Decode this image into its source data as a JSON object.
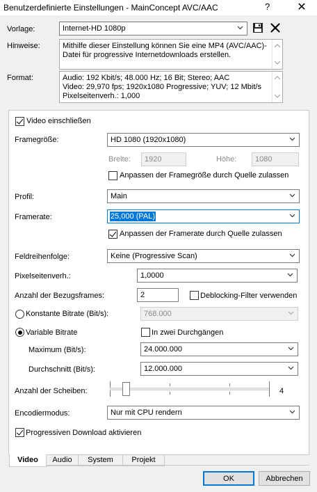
{
  "window": {
    "title": "Benutzerdefinierte Einstellungen - MainConcept AVC/AAC",
    "help": "?",
    "close": "✕"
  },
  "template": {
    "label": "Vorlage:",
    "value": "Internet-HD 1080p"
  },
  "notes": {
    "label": "Hinweise:",
    "text": "Mithilfe dieser Einstellung können Sie eine MP4 (AVC/AAC)-Datei für progressive Internetdownloads erstellen."
  },
  "format": {
    "label": "Format:",
    "lines": [
      "Audio: 192 Kbit/s; 48.000 Hz; 16 Bit; Stereo; AAC",
      "Video: 29,970 fps; 1920x1080 Progressive; YUV; 12 Mbit/s",
      "Pixelseitenverh.: 1,000"
    ]
  },
  "video": {
    "include_label": "Video einschließen",
    "include_checked": true,
    "frame_size_label": "Framegröße:",
    "frame_size_value": "HD 1080 (1920x1080)",
    "width_label": "Breite:",
    "width_value": "1920",
    "height_label": "Höhe:",
    "height_value": "1080",
    "fit_frame_label": "Anpassen der Framegröße durch Quelle zulassen",
    "fit_frame_checked": false,
    "profile_label": "Profil:",
    "profile_value": "Main",
    "framerate_label": "Framerate:",
    "framerate_value": "25,000 (PAL)",
    "fit_rate_label": "Anpassen der Framerate durch Quelle zulassen",
    "fit_rate_checked": true,
    "field_order_label": "Feldreihenfolge:",
    "field_order_value": "Keine (Progressive Scan)",
    "par_label": "Pixelseitenverh.:",
    "par_value": "1,0000",
    "ref_frames_label": "Anzahl der Bezugsframes:",
    "ref_frames_value": "2",
    "deblock_label": "Deblocking-Filter verwenden",
    "deblock_checked": false,
    "cbr_label": "Konstante Bitrate (Bit/s):",
    "cbr_selected": false,
    "cbr_value": "768.000",
    "vbr_label": "Variable Bitrate",
    "vbr_selected": true,
    "two_pass_label": "In zwei Durchgängen",
    "two_pass_checked": false,
    "max_label": "Maximum (Bit/s):",
    "max_value": "24.000.000",
    "avg_label": "Durchschnitt (Bit/s):",
    "avg_value": "12.000.000",
    "slices_label": "Anzahl der Scheiben:",
    "slices_value": "4",
    "slices_slider_level": 0.08,
    "encode_mode_label": "Encodiermodus:",
    "encode_mode_value": "Nur mit CPU rendern",
    "progressive_dl_label": "Progressiven Download aktivieren",
    "progressive_dl_checked": true
  },
  "tabs": [
    "Video",
    "Audio",
    "System",
    "Projekt"
  ],
  "active_tab": "Video",
  "buttons": {
    "ok": "OK",
    "cancel": "Abbrechen"
  },
  "colors": {
    "selection": "#0078d7",
    "default_button_border": "#0078d7"
  }
}
